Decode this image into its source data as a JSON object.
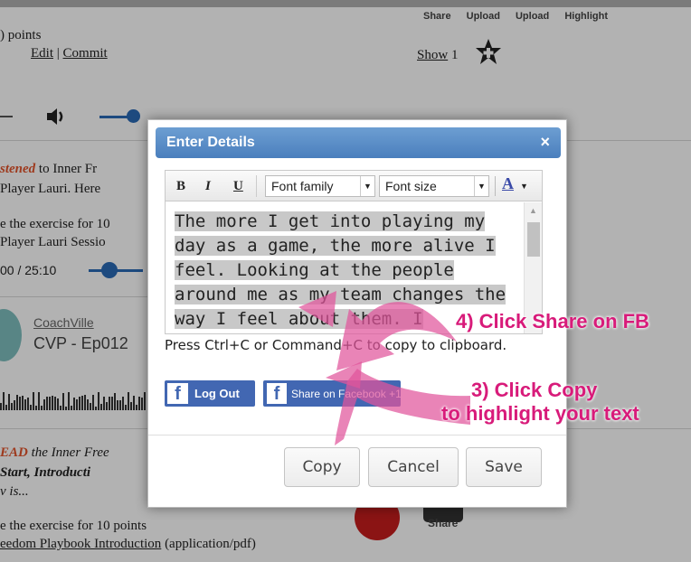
{
  "background": {
    "top_labels": [
      "Share",
      "Upload",
      "Upload",
      "Highlight"
    ],
    "points_text": ") points",
    "edit_link": "Edit",
    "pipe": "|",
    "commit_link": "Commit",
    "show_link": "Show",
    "show_count": "1",
    "listened_prefix": "stened",
    "listened_rest": " to Inner Fr",
    "player_line": " Player Lauri.  Here",
    "exercise_line1": "e the exercise for 10",
    "player_session": " Player Lauri Sessio",
    "time_text": "00 / 25:10",
    "author": "CoachVille",
    "episode": "CVP - Ep012",
    "read_prefix": "EAD",
    "read_rest": " the Inner Free",
    "start_intro": "Start, Introducti",
    "is_text": "v is...",
    "exercise_line2": "e the exercise for 10 points",
    "pdf_link": "eedom Playbook Introduction",
    "pdf_type": " (application/pdf)",
    "share_bottom": "Share"
  },
  "modal": {
    "title": "Enter Details",
    "close": "×",
    "toolbar": {
      "bold": "B",
      "italic": "I",
      "underline": "U",
      "font_family": "Font family",
      "font_size": "Font size",
      "text_color": "A"
    },
    "editor_text": "The more I get into playing my day as a game, the more alive I feel.  Looking at the people around me as my team changes the way I feel about them.  I",
    "help_text": "Press Ctrl+C or Command+C to copy to clipboard.",
    "fb_logout": "Log Out",
    "fb_share": "Share on Facebook +1",
    "buttons": {
      "copy": "Copy",
      "cancel": "Cancel",
      "save": "Save"
    }
  },
  "annotations": {
    "step4": "4) Click Share on FB",
    "step3_line1": "3) Click Copy",
    "step3_line2": "to highlight your text",
    "color": "#d81b7a"
  }
}
